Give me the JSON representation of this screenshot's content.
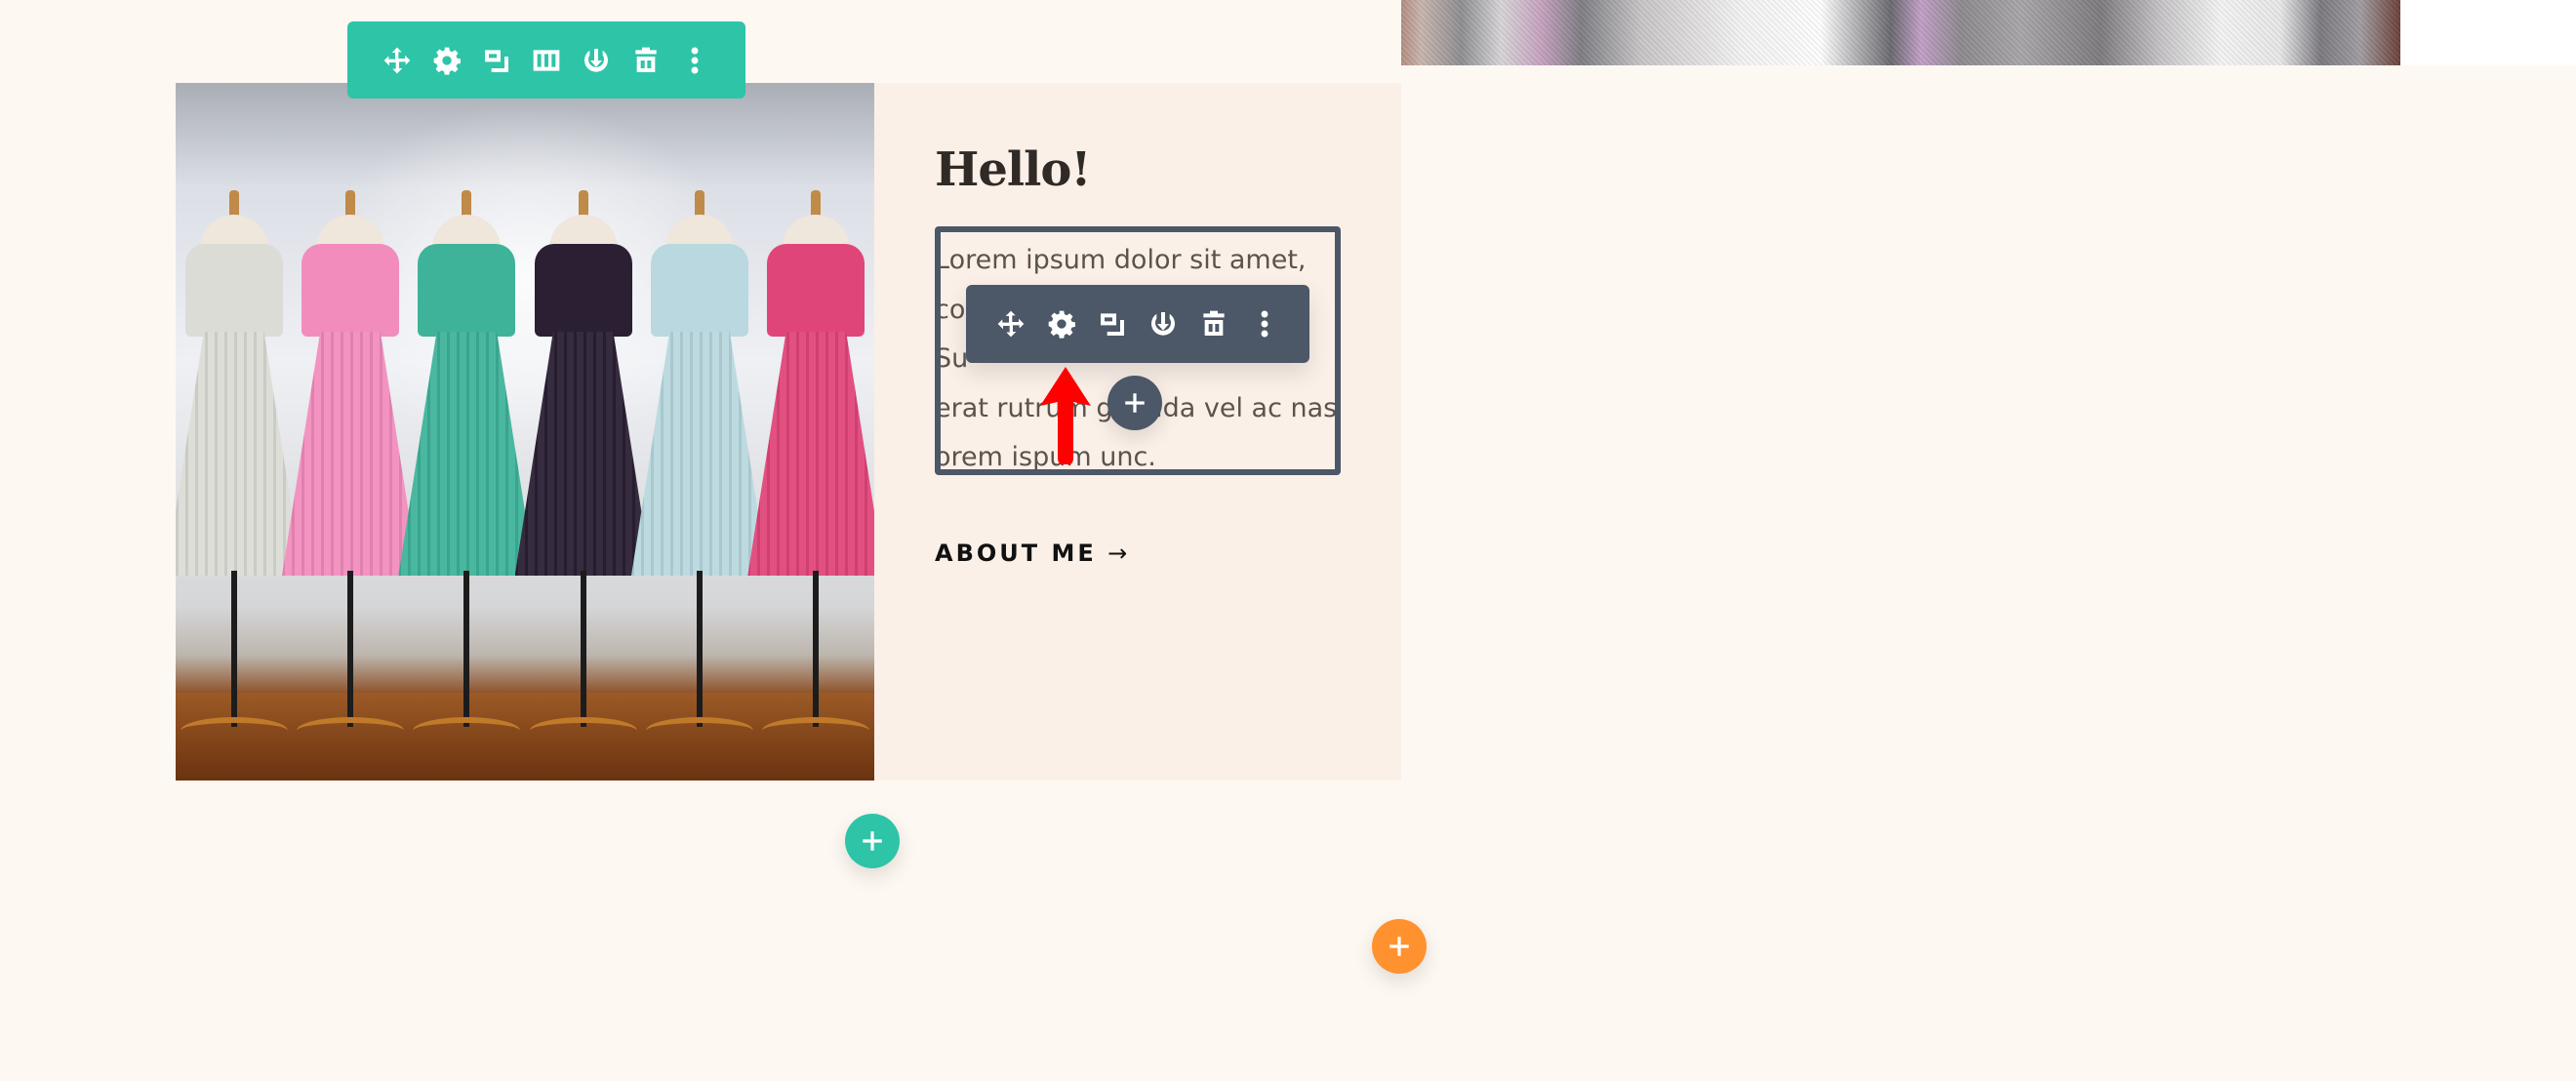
{
  "hero_top": {
    "image_alt": "Close-up of sequined fabric"
  },
  "photo": {
    "alt": "Six dresses on mannequins in a row",
    "dress_colors": [
      "#dcdcd6",
      "#f28cbd",
      "#3fb39a",
      "#2a1f33",
      "#b9d8df",
      "#e0457a"
    ]
  },
  "content": {
    "heading": "Hello!",
    "paragraph_lines": [
      "Lorem ipsum dolor sit amet,",
      "co",
      "Su",
      "erat rutrum gravida vel ac nasd",
      "orem ispum unc."
    ],
    "link_label": "ABOUT ME",
    "link_arrow": "→"
  },
  "row_toolbar": {
    "color": "#2ec4a8",
    "buttons": [
      {
        "name": "move",
        "title": "Move Row"
      },
      {
        "name": "settings",
        "title": "Row Settings"
      },
      {
        "name": "duplicate",
        "title": "Duplicate Row"
      },
      {
        "name": "columns",
        "title": "Change Column Structure"
      },
      {
        "name": "save",
        "title": "Save to Library"
      },
      {
        "name": "delete",
        "title": "Delete Row"
      },
      {
        "name": "more",
        "title": "More Settings"
      }
    ]
  },
  "module_toolbar": {
    "color": "#4c5767",
    "buttons": [
      {
        "name": "move",
        "title": "Move Module"
      },
      {
        "name": "settings",
        "title": "Module Settings"
      },
      {
        "name": "duplicate",
        "title": "Duplicate Module"
      },
      {
        "name": "save",
        "title": "Save to Library"
      },
      {
        "name": "delete",
        "title": "Delete Module"
      },
      {
        "name": "more",
        "title": "More Settings"
      }
    ]
  },
  "add_buttons": {
    "module": {
      "label": "+",
      "color": "#4c5767"
    },
    "row": {
      "label": "+",
      "color": "#2ec4a8"
    },
    "section": {
      "label": "+",
      "color": "#ff922e"
    }
  },
  "annotation": {
    "arrow_color": "#ff0000",
    "points_to": "module settings (gear) button"
  }
}
